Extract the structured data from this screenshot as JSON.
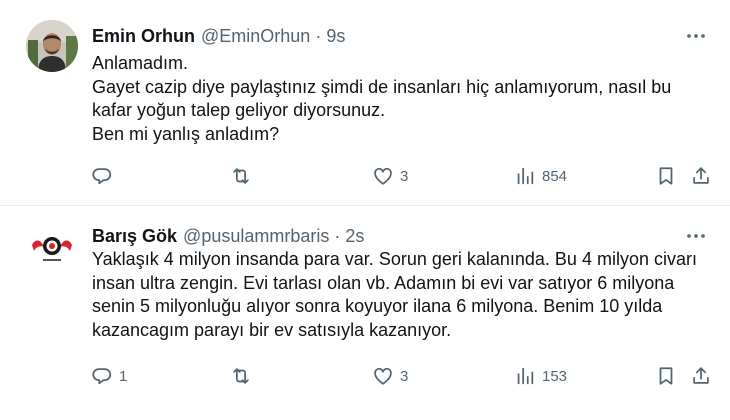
{
  "tweets": [
    {
      "name": "Emin Orhun",
      "handle": "@EminOrhun",
      "separator": "·",
      "time": "9s",
      "lines": [
        "Anlamadım.",
        "Gayet cazip diye paylaştınız şimdi de insanları hiç anlamıyorum, nasıl bu",
        "kafar yoğun talep geliyor diyorsunuz.",
        "Ben mi yanlış anladım?"
      ],
      "replies": "",
      "retweets": "",
      "likes": "3",
      "views": "854"
    },
    {
      "name": "Barış Gök",
      "handle": "@pusulammrbaris",
      "separator": "·",
      "time": "2s",
      "lines": [
        "Yaklaşık 4 milyon insanda para var. Sorun geri kalanında. Bu 4 milyon civarı",
        "insan ultra zengin. Evi tarlası olan vb. Adamın bi evi var satıyor 6 milyona",
        "senin 5 milyonluğu alıyor sonra koyuyor ilana 6 milyona. Benim 10 yılda",
        "kazancagım parayı bir ev satısıyla kazanıyor."
      ],
      "replies": "1",
      "retweets": "",
      "likes": "3",
      "views": "153"
    }
  ],
  "icons": {
    "more": "more-horizontal-icon",
    "reply": "reply-icon",
    "retweet": "retweet-icon",
    "like": "heart-icon",
    "views": "views-chart-icon",
    "bookmark": "bookmark-icon",
    "share": "share-icon"
  },
  "colors": {
    "text": "#0f1419",
    "secondary": "#536471",
    "divider": "#e6ecf0",
    "logo_red": "#d7262b"
  }
}
